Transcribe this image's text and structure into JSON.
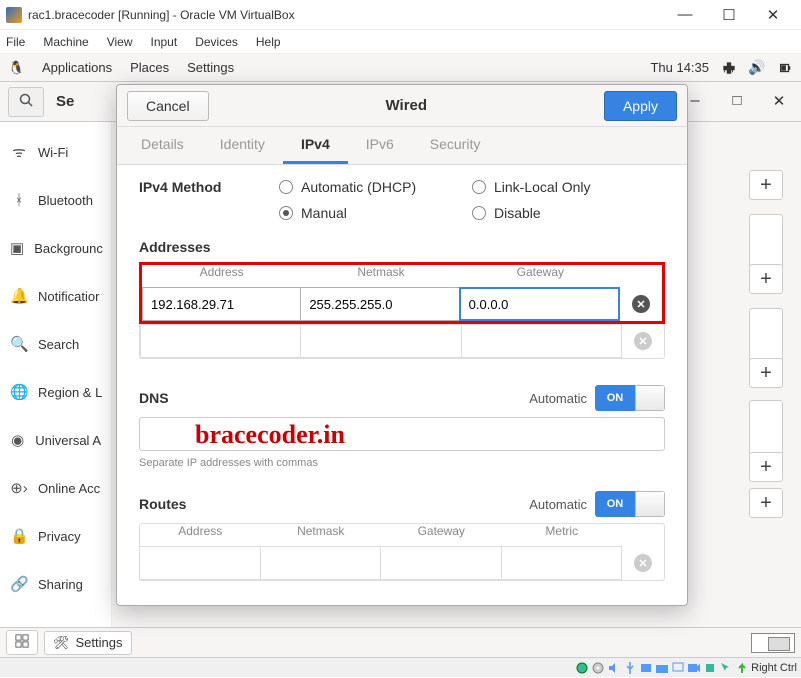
{
  "window": {
    "title": "rac1.bracecoder [Running] - Oracle VM VirtualBox",
    "menu": [
      "File",
      "Machine",
      "View",
      "Input",
      "Devices",
      "Help"
    ]
  },
  "gnome": {
    "applications": "Applications",
    "places": "Places",
    "settings": "Settings",
    "clock": "Thu 14:35"
  },
  "settings_header": {
    "title": "Se"
  },
  "sidebar": {
    "items": [
      {
        "label": "Wi-Fi"
      },
      {
        "label": "Bluetooth"
      },
      {
        "label": "Backgrounc"
      },
      {
        "label": "Notificatior"
      },
      {
        "label": "Search"
      },
      {
        "label": "Region & L"
      },
      {
        "label": "Universal A"
      },
      {
        "label": "Online Acc"
      },
      {
        "label": "Privacy"
      },
      {
        "label": "Sharing"
      }
    ]
  },
  "dialog": {
    "cancel": "Cancel",
    "apply": "Apply",
    "title": "Wired",
    "tabs": [
      "Details",
      "Identity",
      "IPv4",
      "IPv6",
      "Security"
    ],
    "active_tab": "IPv4",
    "ipv4": {
      "method_title": "IPv4 Method",
      "methods": {
        "auto": "Automatic (DHCP)",
        "manual": "Manual",
        "linklocal": "Link-Local Only",
        "disable": "Disable"
      },
      "addresses": {
        "title": "Addresses",
        "columns": [
          "Address",
          "Netmask",
          "Gateway"
        ],
        "row": {
          "address": "192.168.29.71",
          "netmask": "255.255.255.0",
          "gateway": "0.0.0.0"
        }
      },
      "dns": {
        "title": "DNS",
        "automatic": "Automatic",
        "toggle": "ON",
        "hint": "Separate IP addresses with commas"
      },
      "routes": {
        "title": "Routes",
        "automatic": "Automatic",
        "toggle": "ON",
        "columns": [
          "Address",
          "Netmask",
          "Gateway",
          "Metric"
        ]
      }
    }
  },
  "watermark": "bracecoder.in",
  "taskbar": {
    "settings": "Settings"
  },
  "vb_status": {
    "rctrl": "Right Ctrl"
  }
}
